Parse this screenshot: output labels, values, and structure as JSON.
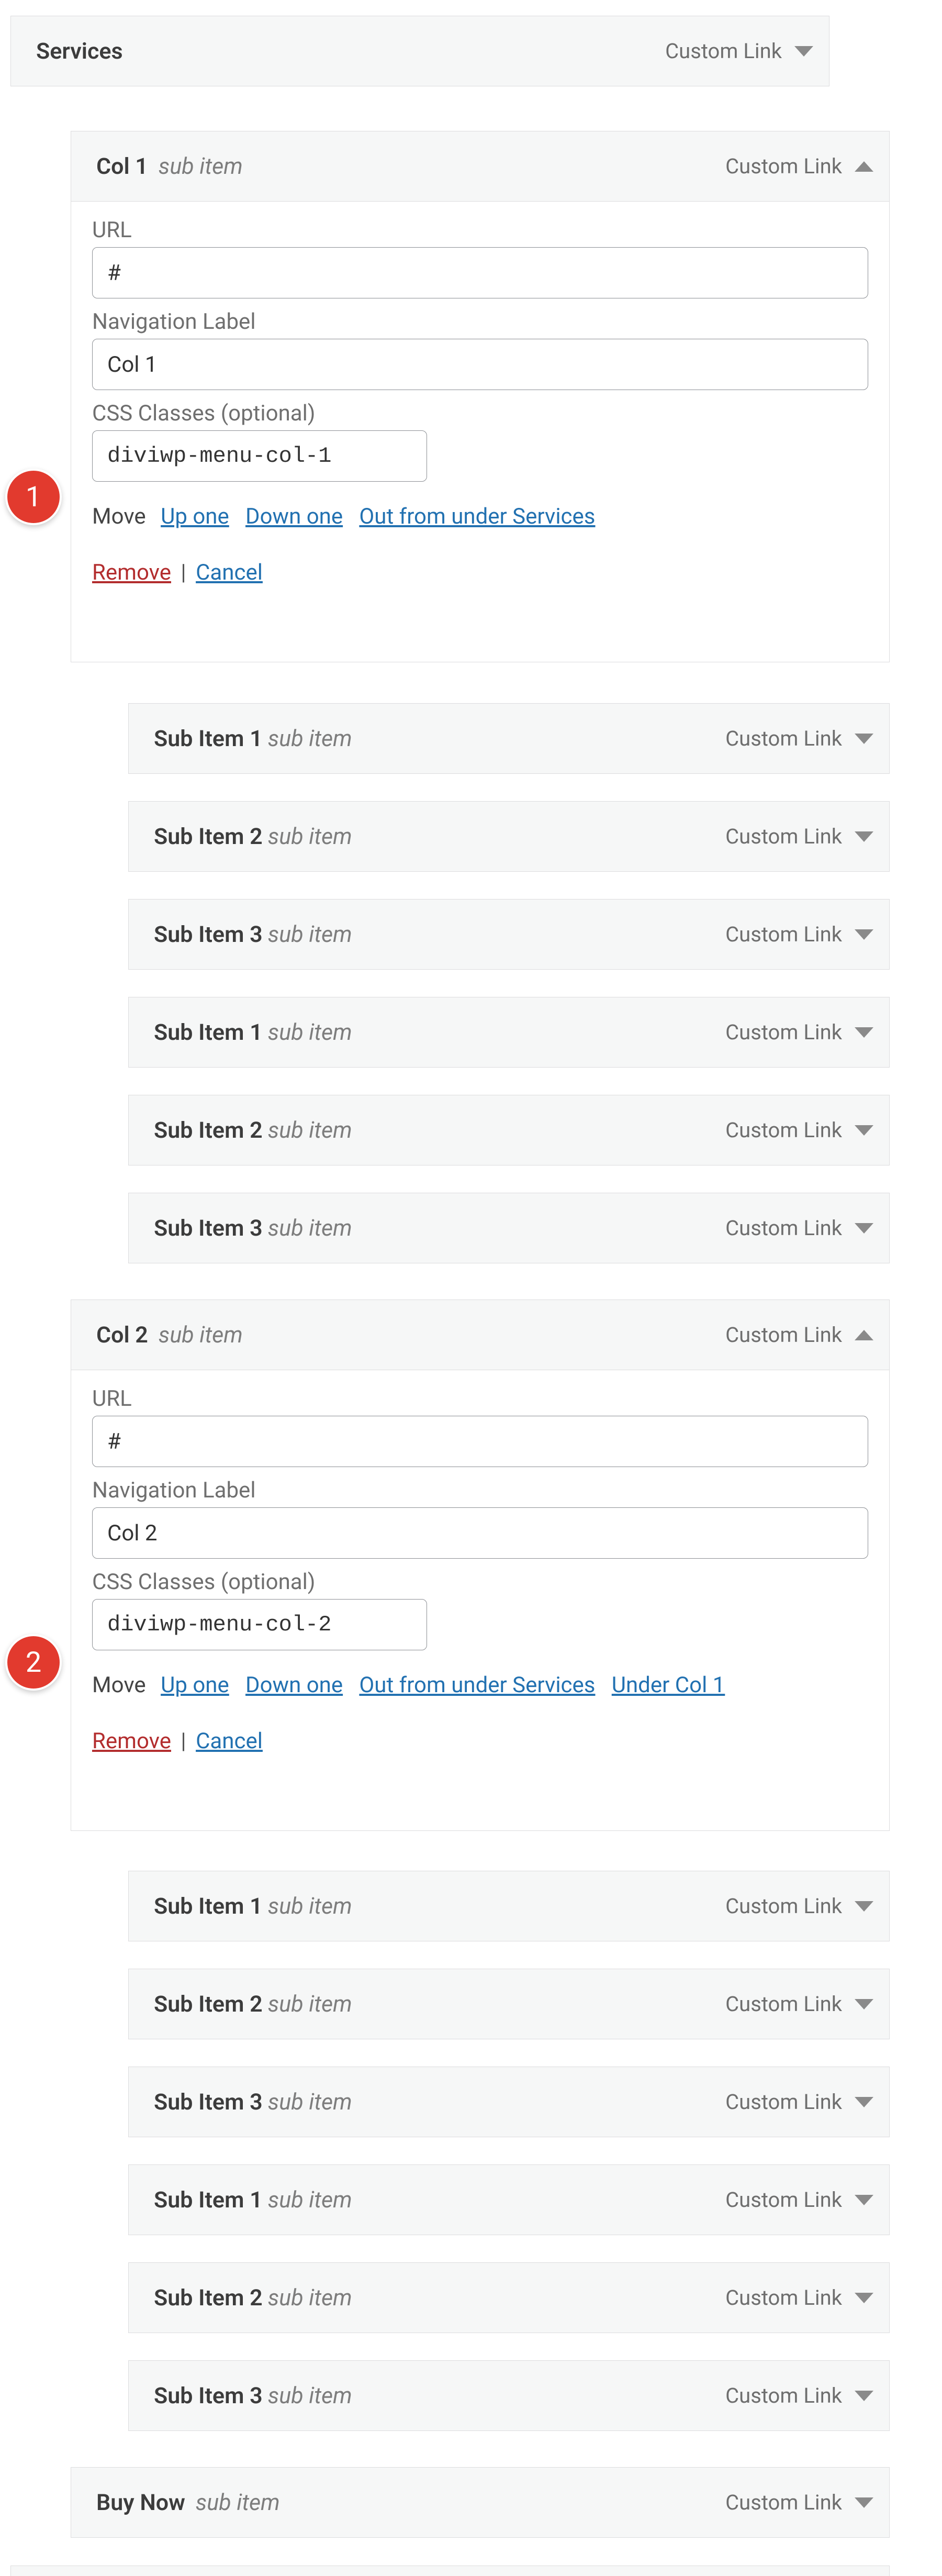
{
  "labels": {
    "sub_item": "sub item",
    "type": "Custom Link",
    "url": "URL",
    "nav_label": "Navigation Label",
    "css_classes": "CSS Classes (optional)",
    "move": "Move",
    "up_one": "Up one",
    "down_one": "Down one",
    "out_from_under": "Out from under Services",
    "under_col1": "Under Col 1",
    "remove": "Remove",
    "cancel": "Cancel",
    "pipe": "|"
  },
  "badges": {
    "one": "1",
    "two": "2"
  },
  "items": {
    "services": {
      "title": "Services"
    },
    "col1": {
      "title": "Col 1",
      "url": "#",
      "nav_label": "Col 1",
      "css": "diviwp-menu-col-1"
    },
    "col2": {
      "title": "Col 2",
      "url": "#",
      "nav_label": "Col 2",
      "css": "diviwp-menu-col-2"
    },
    "buy_now": {
      "title": "Buy Now"
    },
    "sub1": {
      "title": "Sub Item 1"
    },
    "sub2": {
      "title": "Sub Item 2"
    },
    "sub3": {
      "title": "Sub Item 3"
    }
  }
}
